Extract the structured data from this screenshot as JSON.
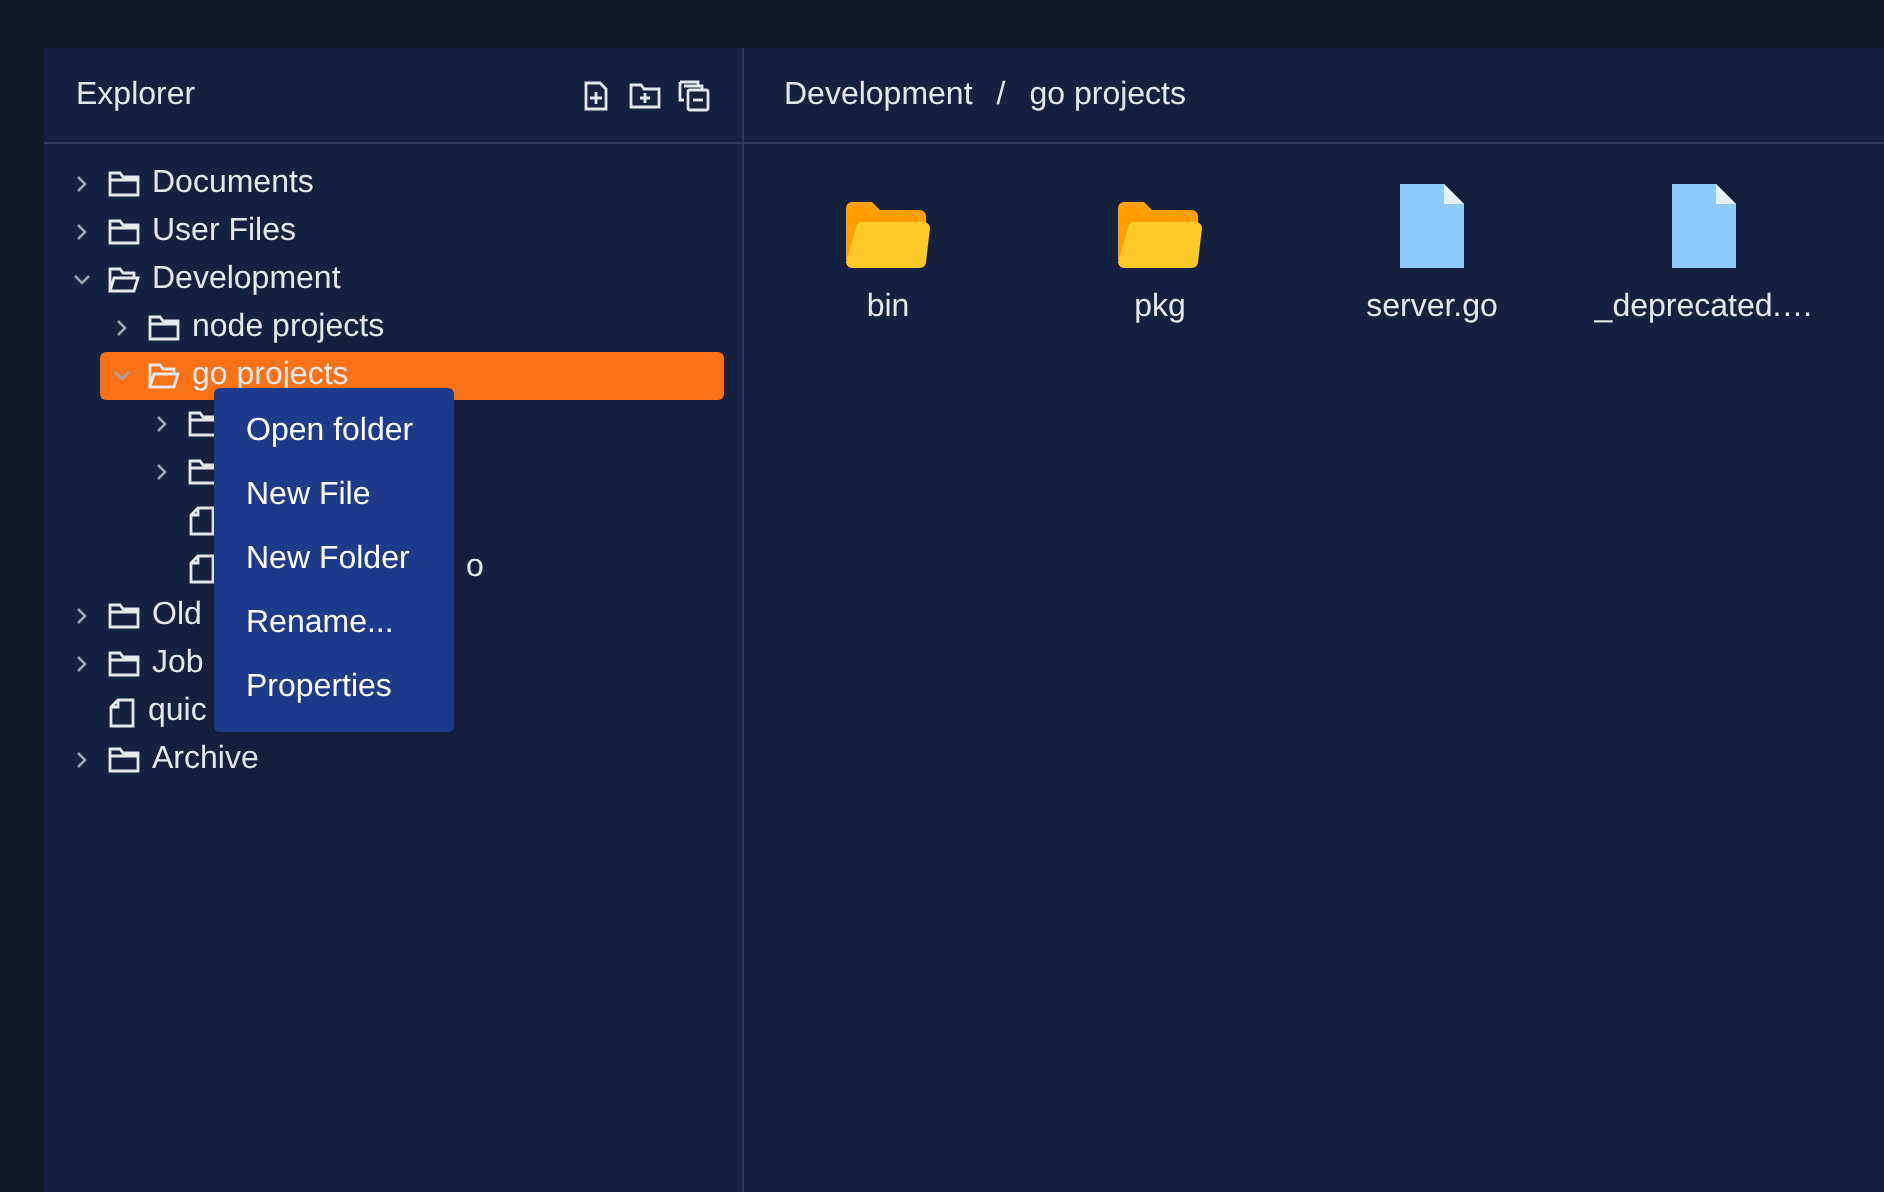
{
  "sidebar": {
    "title": "Explorer",
    "tree": [
      {
        "kind": "folder",
        "label": "Documents",
        "expanded": false,
        "selected": false
      },
      {
        "kind": "folder",
        "label": "User Files",
        "expanded": false,
        "selected": false
      },
      {
        "kind": "folder",
        "label": "Development",
        "expanded": true,
        "selected": false,
        "children": [
          {
            "kind": "folder",
            "label": "node projects",
            "expanded": false,
            "selected": false
          },
          {
            "kind": "folder",
            "label": "go projects",
            "expanded": true,
            "selected": true,
            "children": [
              {
                "kind": "folder",
                "expanded": false,
                "selected": false
              },
              {
                "kind": "folder",
                "expanded": false,
                "selected": false
              },
              {
                "kind": "file",
                "selected": false
              },
              {
                "kind": "file",
                "selected": false,
                "label_tail": "o"
              }
            ]
          }
        ]
      },
      {
        "kind": "folder",
        "label": "Old",
        "expanded": false,
        "selected": false
      },
      {
        "kind": "folder",
        "label": "Job",
        "expanded": false,
        "selected": false
      },
      {
        "kind": "file",
        "label": "quic",
        "selected": false
      },
      {
        "kind": "folder",
        "label": "Archive",
        "expanded": false,
        "selected": false
      }
    ]
  },
  "context_menu": [
    "Open folder",
    "New File",
    "New Folder",
    "Rename...",
    "Properties"
  ],
  "breadcrumb": [
    "Development",
    "go projects"
  ],
  "breadcrumb_separator": "/",
  "items": [
    {
      "kind": "folder",
      "label": "bin"
    },
    {
      "kind": "folder",
      "label": "pkg"
    },
    {
      "kind": "file",
      "label": "server.go"
    },
    {
      "kind": "file",
      "label": "_deprecated.…"
    }
  ]
}
